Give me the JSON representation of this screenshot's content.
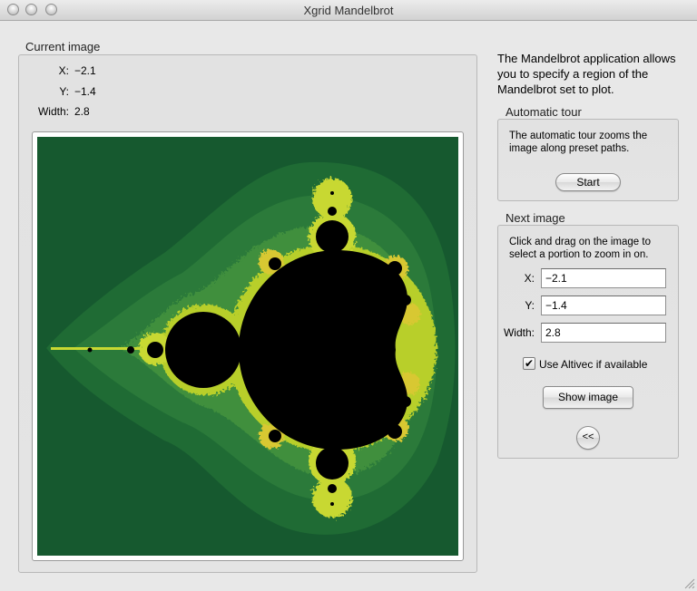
{
  "window": {
    "title": "Xgrid Mandelbrot"
  },
  "current_image": {
    "label": "Current image",
    "x_label": "X:",
    "x_value": "−2.1",
    "y_label": "Y:",
    "y_value": "−1.4",
    "width_label": "Width:",
    "width_value": "2.8"
  },
  "intro": "The Mandelbrot application allows you to specify a region of the Mandelbrot set to plot.",
  "automatic_tour": {
    "label": "Automatic tour",
    "description": "The automatic tour zooms the image along preset paths.",
    "start_button": "Start"
  },
  "next_image": {
    "label": "Next image",
    "instructions": "Click and drag on the image to select a portion to zoom in on.",
    "x_label": "X:",
    "x_value": "−2.1",
    "y_label": "Y:",
    "y_value": "−1.4",
    "width_label": "Width:",
    "width_value": "2.8",
    "altivec_label": "Use Altivec if available",
    "altivec_checked": true,
    "show_button": "Show image",
    "back_button": "<<"
  },
  "colors": {
    "fractal_bg": "#16592f",
    "fractal_outer": "#2b7a3a",
    "fractal_mid": "#3f8f3c",
    "fractal_edge": "#c8d832",
    "set": "#000000"
  }
}
